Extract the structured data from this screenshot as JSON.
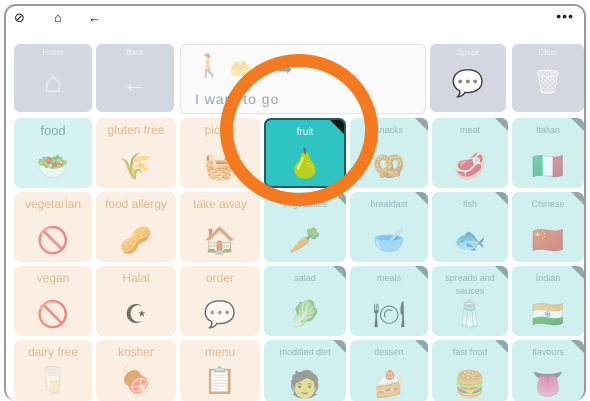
{
  "topbar": {
    "compass_icon": "compass-icon",
    "home_icon": "home-icon",
    "back_icon": "back-arrow-icon",
    "more_label": "•••"
  },
  "toolbar": {
    "home_label": "Home",
    "back_label": "Back",
    "speak_label": "Speak",
    "clear_label": "Clear"
  },
  "sentence": {
    "text": "I  want to  go"
  },
  "grid": {
    "col1": [
      "food",
      "vegetarian",
      "vegan",
      "dairy free"
    ],
    "col2": [
      "gluten free",
      "food allergy",
      "Halal",
      "kosher"
    ],
    "col3": [
      "picnic",
      "take away",
      "order",
      "menu"
    ],
    "col4": [
      "fruit",
      "vegetables",
      "salad",
      "modified diet"
    ],
    "col5": [
      "snacks",
      "breakfast",
      "meals",
      "dessert"
    ],
    "col6": [
      "meat",
      "fish",
      "spreads and sauces",
      "fast food"
    ],
    "col7": [
      "Italian",
      "Chinese",
      "Indian",
      "flavours"
    ]
  },
  "colors": {
    "highlight_ring": "#f57a1f",
    "selected_cell": "#2ec4c2",
    "category_cell": "#d0f0f0",
    "beige_cell": "#fbefe3"
  }
}
